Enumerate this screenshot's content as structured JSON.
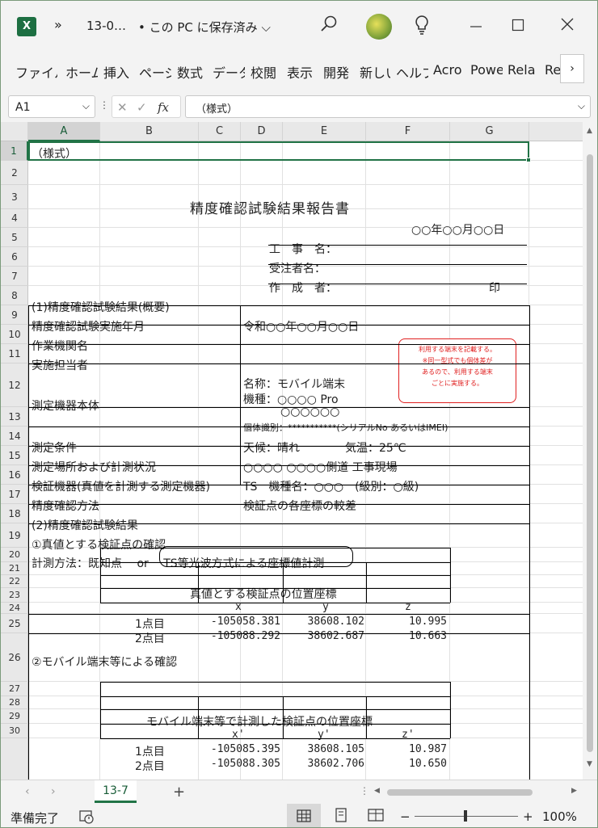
{
  "app": {
    "icon": "X",
    "doc_title": "13-0…",
    "save_status": "• この PC に保存済み ⌵",
    "more": "»"
  },
  "ribbon": {
    "tabs": [
      "ファイル",
      "ホーム",
      "挿入",
      "ページ",
      "数式",
      "データ",
      "校閲",
      "表示",
      "開発",
      "新しい",
      "ヘルプ",
      "Acro",
      "Powe",
      "Rela",
      "Re"
    ],
    "next": "›"
  },
  "formula_bar": {
    "name_box": "A1",
    "cancel": "✕",
    "enter": "✓",
    "fx": "fx",
    "content": "（様式）"
  },
  "columns": [
    "A",
    "B",
    "C",
    "D",
    "E",
    "F",
    "G"
  ],
  "rows": [
    "1",
    "2",
    "3",
    "4",
    "5",
    "6",
    "7",
    "8",
    "9",
    "10",
    "11",
    "12",
    "13",
    "14",
    "15",
    "16",
    "17",
    "18",
    "19",
    "20",
    "21",
    "22",
    "23",
    "24",
    "25",
    "26",
    "27",
    "28",
    "29",
    "30"
  ],
  "cells": {
    "a1": "（様式）",
    "title": "精度確認試験結果報告書",
    "date": "○○年○○月○○日",
    "work_name_label": "工　事　名：",
    "contractor_label": "受注者名：",
    "author_label": "作　成　者：",
    "seal": "印",
    "section1": "(1)精度確認試験結果(概要)",
    "r9_label": "精度確認試験実施年月",
    "r9_value": "令和○○年○○月○○日",
    "r10_label": "作業機関名",
    "r11_label": "実施担当者",
    "r12_label": "測定機器本体",
    "r12_name": "名称：モバイル端末",
    "r12_model": "機種：○○○○ Pro",
    "r12_model2": "○○○○○○",
    "r12_serial": "個体識別：***********(シリアルNo あるいはIMEI)",
    "r13_label": "測定条件",
    "r13_weather": "天候：晴れ",
    "r13_temp": "気温：25℃",
    "r14_label": "測定場所および計測状況",
    "r14_value": "○○○○ ○○○○側道 工事現場",
    "r15_label": "検証機器(真値を計測する測定機器)",
    "r15_value": "TS　機種名：○○○　(級別：○級)",
    "r16_label": "精度確認方法",
    "r16_value": "検証点の各座標の較差",
    "section2": "(2)精度確認試験結果",
    "sub1": "①真値とする検証点の確認",
    "method": "計測方法：既知点　 or 　TS等光波方式による座標値計測",
    "sub2": "②モバイル端末等による確認"
  },
  "table1": {
    "title": "真値とする検証点の位置座標",
    "headers": [
      "",
      "x",
      "y",
      "z"
    ],
    "rows": [
      [
        "1点目",
        "-105058.381",
        "38608.102",
        "10.995"
      ],
      [
        "2点目",
        "-105088.292",
        "38602.687",
        "10.663"
      ]
    ]
  },
  "table2": {
    "title": "モバイル端末等で計測した検証点の位置座標",
    "headers": [
      "",
      "x'",
      "y'",
      "z'"
    ],
    "rows": [
      [
        "1点目",
        "-105085.395",
        "38608.105",
        "10.987"
      ],
      [
        "2点目",
        "-105088.305",
        "38602.706",
        "10.650"
      ]
    ]
  },
  "callout": {
    "line1": "利用する端末を記載する。",
    "line2": "※同一型式でも個体差が",
    "line3": "あるので、利用する端末",
    "line4": "ごとに実施する。",
    "color": "#e02020"
  },
  "sheet_tabs": {
    "active": "13-7",
    "add": "+"
  },
  "status": {
    "ready": "準備完了",
    "zoom_minus": "−",
    "zoom_plus": "+",
    "zoom": "100%"
  },
  "colors": {
    "excel_green": "#217346",
    "chrome_bg": "#f3f3f3"
  }
}
